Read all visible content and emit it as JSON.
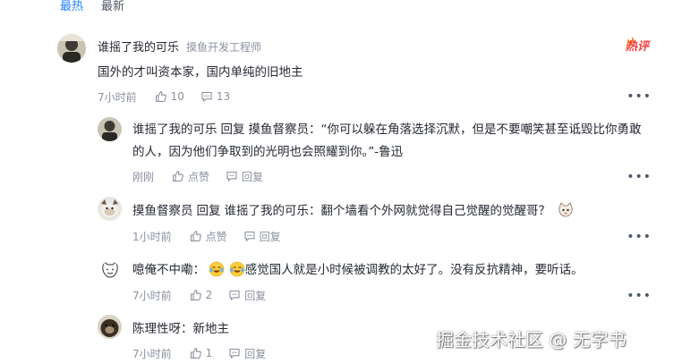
{
  "tabs": {
    "hot": "最热",
    "latest": "最新"
  },
  "colors": {
    "accent": "#1e80ff",
    "hot": "#f53f3f",
    "muted": "#8a919f"
  },
  "main_comment": {
    "user": "谁摇了我的可乐",
    "title": "摸鱼开发工程师",
    "badge": "热评",
    "text": "国外的才叫资本家，国内单纯的旧地主",
    "time": "7小时前",
    "likes": "10",
    "comments": "13"
  },
  "replies": [
    {
      "user": "谁摇了我的可乐",
      "reply_word": "回复",
      "target": "摸鱼督察员",
      "text_line1": "：“你可以躲在角落选择沉默，但是不要嘲笑甚至诋毁比你勇敢",
      "text_line2": "的人，因为他们争取到的光明也会照耀到你。”-鲁迅",
      "time": "刚刚",
      "like_label": "点赞",
      "reply_label": "回复"
    },
    {
      "user": "摸鱼督察员",
      "reply_word": "回复",
      "target": "谁摇了我的可乐",
      "text": "：翻个墙看个外网就觉得自己觉醒的觉醒哥？",
      "time": "1小时前",
      "like_label": "点赞",
      "reply_label": "回复"
    },
    {
      "user": "噫俺不中嘞",
      "text": "感觉国人就是小时候被调教的太好了。没有反抗精神，要听话。",
      "time": "7小时前",
      "likes": "2",
      "reply_label": "回复"
    },
    {
      "user": "陈理性呀",
      "text": "：新地主",
      "time": "7小时前",
      "likes": "1",
      "reply_label": "回复"
    }
  ],
  "watermark": "掘金技术社区 @ 无字书",
  "icons": {
    "like": "thumb-up-icon",
    "comment": "comment-bubble-icon",
    "more": "more-dots-icon"
  }
}
